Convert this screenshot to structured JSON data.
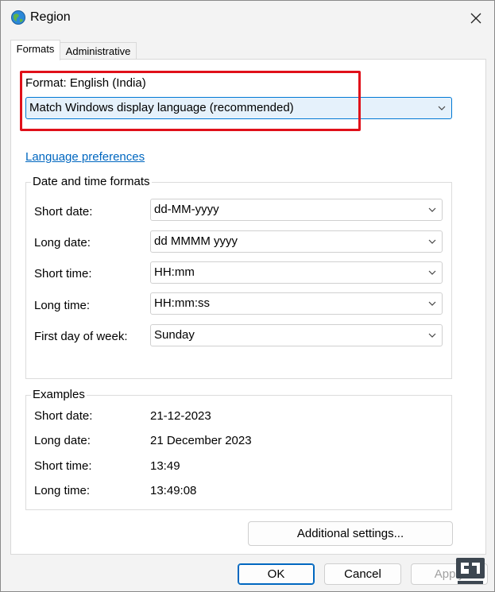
{
  "window": {
    "title": "Region"
  },
  "tabs": [
    {
      "label": "Formats"
    },
    {
      "label": "Administrative"
    }
  ],
  "format": {
    "label": "Format: English (India)",
    "selected": "Match Windows display language (recommended)"
  },
  "links": {
    "language_preferences": "Language preferences"
  },
  "date_time_formats": {
    "title": "Date and time formats",
    "rows": [
      {
        "label": "Short date:",
        "value": "dd-MM-yyyy"
      },
      {
        "label": "Long date:",
        "value": "dd MMMM yyyy"
      },
      {
        "label": "Short time:",
        "value": "HH:mm"
      },
      {
        "label": "Long time:",
        "value": "HH:mm:ss"
      },
      {
        "label": "First day of week:",
        "value": "Sunday"
      }
    ]
  },
  "examples": {
    "title": "Examples",
    "rows": [
      {
        "label": "Short date:",
        "value": "21-12-2023"
      },
      {
        "label": "Long date:",
        "value": "21 December 2023"
      },
      {
        "label": "Short time:",
        "value": "13:49"
      },
      {
        "label": "Long time:",
        "value": "13:49:08"
      }
    ]
  },
  "buttons": {
    "additional_settings": "Additional settings...",
    "ok": "OK",
    "cancel": "Cancel",
    "apply": "Apply"
  },
  "colors": {
    "accent": "#0078d4",
    "highlight_box": "#e0101a",
    "link": "#0067c0"
  },
  "icons": {
    "app": "globe-icon",
    "close": "close-icon",
    "dropdown": "chevron-down-icon"
  }
}
